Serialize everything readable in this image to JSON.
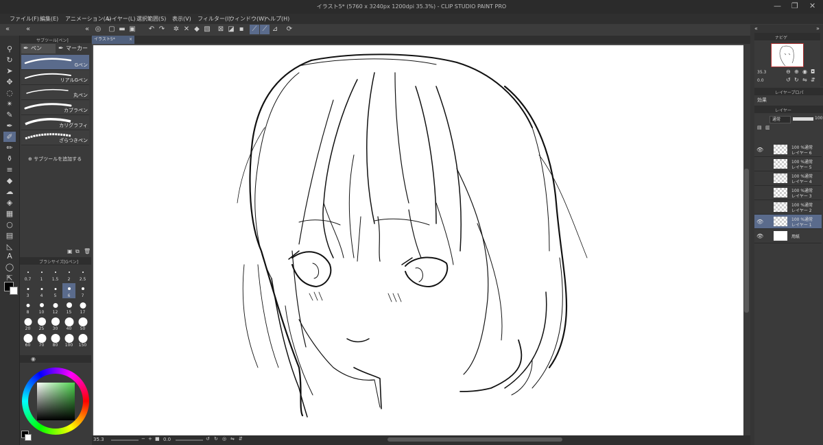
{
  "app": {
    "title": "イラスト5* (5760 x 3240px 1200dpi 35.3%) - CLIP STUDIO PAINT PRO"
  },
  "menu": [
    "ファイル(F)",
    "編集(E)",
    "アニメーション(A)",
    "レイヤー(L)",
    "選択範囲(S)",
    "表示(V)",
    "フィルター(I)",
    "ウィンドウ(W)",
    "ヘルプ(H)"
  ],
  "subtool": {
    "header": "サブツール[ペン]",
    "tabs": [
      "ペン",
      "マーカー"
    ],
    "brushes": [
      {
        "label": "Gペン",
        "selected": true
      },
      {
        "label": "リアルGペン",
        "selected": false
      },
      {
        "label": "丸ペン",
        "selected": false
      },
      {
        "label": "カブラペン",
        "selected": false
      },
      {
        "label": "カリグラフィ",
        "selected": false
      },
      {
        "label": "ざらつきペン",
        "selected": false
      }
    ],
    "add_label": "サブツールを追加する"
  },
  "brushsize": {
    "header": "ブラシサイズ[Gペン]",
    "sizes": [
      "0.7",
      "1",
      "1.5",
      "2",
      "2.5",
      "3",
      "4",
      "5",
      "6",
      "7",
      "8",
      "10",
      "12",
      "15",
      "17",
      "20",
      "25",
      "30",
      "40",
      "50",
      "60",
      "70",
      "80",
      "100",
      "150"
    ],
    "selected_index": 8
  },
  "colors": {
    "main": "#000000",
    "sub": "#ffffff",
    "accent": "#5a6b8c",
    "hue": "#4cd34c"
  },
  "document": {
    "tab": "イラスト5*"
  },
  "status": {
    "zoom": "35.3",
    "rotation": "0.0"
  },
  "navigator": {
    "header": "ナビゲ",
    "zoom": "35.3",
    "rotation": "0.0"
  },
  "layer_property": {
    "header": "レイヤープロパ",
    "effect": "効果"
  },
  "layers": {
    "header": "レイヤー",
    "blend": "通常",
    "opacity": "100",
    "items": [
      {
        "name": "レイヤー 6",
        "mode": "100 %通常",
        "visible": true,
        "selected": false
      },
      {
        "name": "レイヤー 5",
        "mode": "100 %通常",
        "visible": false,
        "selected": false
      },
      {
        "name": "レイヤー 4",
        "mode": "100 %通常",
        "visible": false,
        "selected": false
      },
      {
        "name": "レイヤー 3",
        "mode": "100 %通常",
        "visible": false,
        "selected": false
      },
      {
        "name": "レイヤー 2",
        "mode": "100 %通常",
        "visible": false,
        "selected": false
      },
      {
        "name": "レイヤー 1",
        "mode": "100 %通常",
        "visible": true,
        "selected": true
      },
      {
        "name": "用紙",
        "mode": "",
        "visible": true,
        "selected": false
      }
    ]
  }
}
